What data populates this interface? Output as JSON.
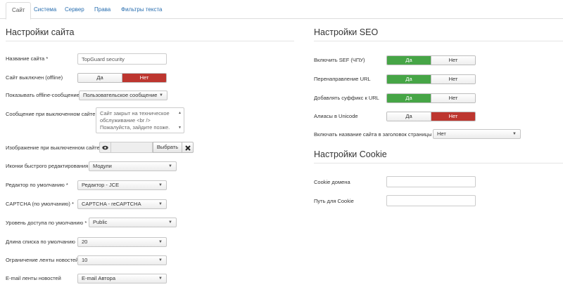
{
  "tabs": [
    {
      "label": "Сайт"
    },
    {
      "label": "Система"
    },
    {
      "label": "Сервер"
    },
    {
      "label": "Права"
    },
    {
      "label": "Фильтры текста"
    }
  ],
  "site_settings": {
    "title": "Настройки сайта",
    "site_name": {
      "label": "Название сайта *",
      "value": "TopGuard security"
    },
    "offline": {
      "label": "Сайт выключен (offline)",
      "yes": "Да",
      "no": "Нет",
      "selected": "no"
    },
    "offline_message_type": {
      "label": "Показывать offline-сообщение",
      "value": "Пользовательское сообщение"
    },
    "offline_message": {
      "label": "Сообщение при выключенном сайте",
      "value": "Сайт закрыт на техническое обслуживание <br /> Пожалуйста, зайдите позже."
    },
    "offline_image": {
      "label": "Изображение при выключенном сайте",
      "choose": "Выбрать"
    },
    "frontend_edit": {
      "label": "Иконки быстрого редактирования",
      "value": "Модули"
    },
    "default_editor": {
      "label": "Редактор по умолчанию *",
      "value": "Редактор - JCE"
    },
    "captcha": {
      "label": "CAPTCHA (по умолчанию) *",
      "value": "CAPTCHA - reCAPTCHA"
    },
    "access_level": {
      "label": "Уровень доступа по умолчанию *",
      "value": "Public"
    },
    "list_length": {
      "label": "Длина списка по умолчанию",
      "value": "20"
    },
    "feed_limit": {
      "label": "Ограничение ленты новостей",
      "value": "10"
    },
    "feed_email": {
      "label": "E-mail ленты новостей",
      "value": "E-mail Автора"
    }
  },
  "seo_settings": {
    "title": "Настройки SEO",
    "sef": {
      "label": "Включить SEF (ЧПУ)",
      "yes": "Да",
      "no": "Нет",
      "selected": "yes"
    },
    "rewrite": {
      "label": "Перенаправление URL",
      "yes": "Да",
      "no": "Нет",
      "selected": "yes"
    },
    "suffix": {
      "label": "Добавлять суффикс к URL",
      "yes": "Да",
      "no": "Нет",
      "selected": "yes"
    },
    "unicode": {
      "label": "Алиасы в Unicode",
      "yes": "Да",
      "no": "Нет",
      "selected": "no"
    },
    "sitename_pagetitles": {
      "label": "Включать название сайта в заголовок страницы",
      "value": "Нет"
    }
  },
  "cookie_settings": {
    "title": "Настройки Cookie",
    "domain": {
      "label": "Cookie домена",
      "value": ""
    },
    "path": {
      "label": "Путь для Cookie",
      "value": ""
    }
  },
  "colors": {
    "yes_active": "#46a546",
    "no_active": "#bd362f",
    "link": "#2a6fb0"
  }
}
